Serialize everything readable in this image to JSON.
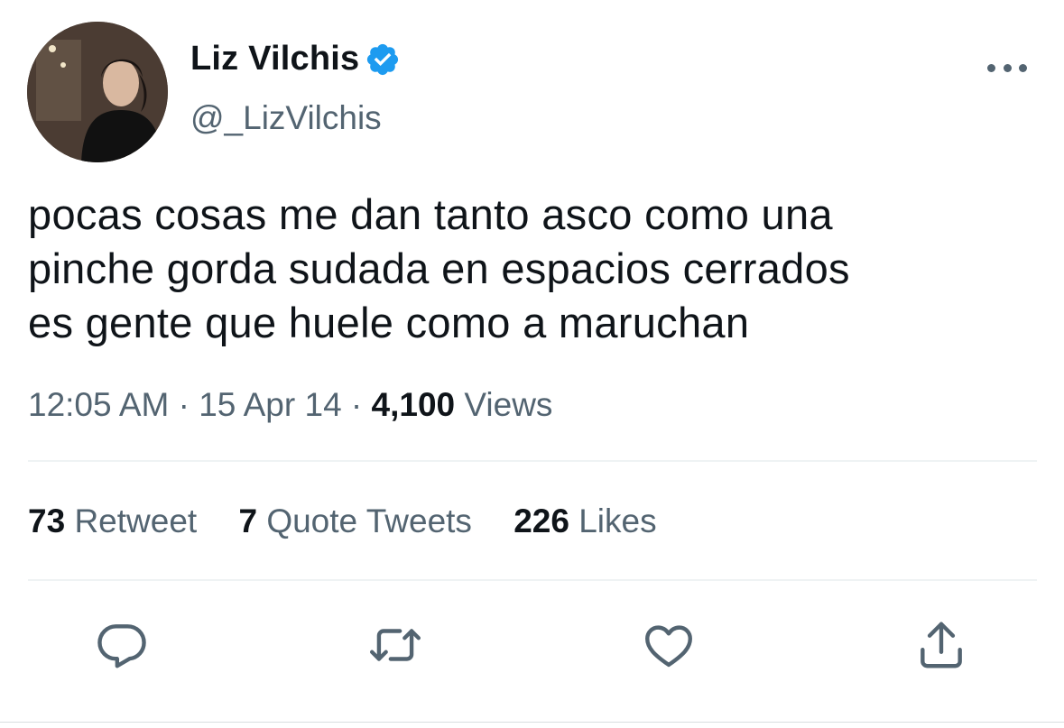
{
  "author": {
    "display_name": "Liz Vilchis",
    "handle": "@_LizVilchis",
    "verified": true
  },
  "tweet": {
    "lines": [
      "pocas cosas me dan tanto asco como una",
      "pinche gorda sudada en espacios cerrados",
      "es gente que huele como a maruchan"
    ],
    "time": "12:05 AM",
    "separator": "·",
    "date": "15 Apr 14",
    "views_count": "4,100",
    "views_label": "Views"
  },
  "stats": {
    "retweets_count": "73",
    "retweets_label": "Retweet",
    "quotes_count": "7",
    "quotes_label": "Quote Tweets",
    "likes_count": "226",
    "likes_label": "Likes"
  },
  "icons": {
    "verified": "verified-badge-icon",
    "more": "more-options-icon",
    "reply": "reply-icon",
    "retweet": "retweet-icon",
    "like": "heart-icon",
    "share": "share-icon"
  },
  "colors": {
    "text": "#0f1419",
    "secondary": "#536471",
    "verified": "#1d9bf0",
    "divider": "#eff3f4"
  }
}
